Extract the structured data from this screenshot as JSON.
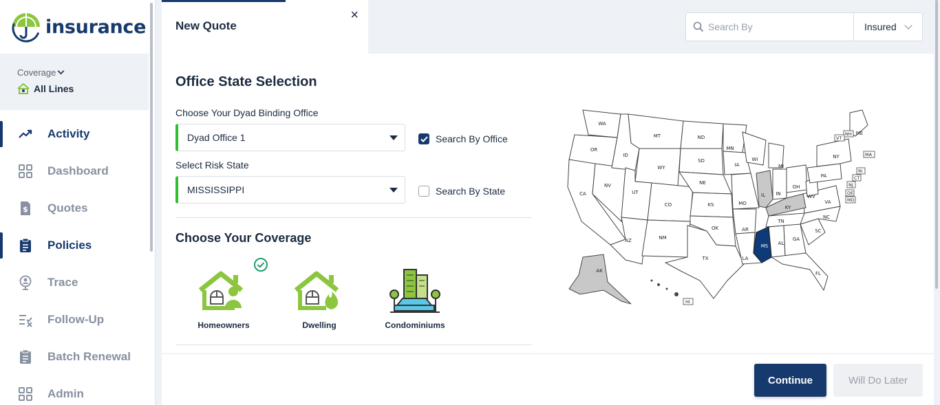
{
  "brand": {
    "name": "insurance",
    "collapse_icon": "chevron-left-icon"
  },
  "coverage": {
    "label": "Coverage",
    "value": "All Lines"
  },
  "nav": {
    "items": [
      {
        "label": "Activity",
        "icon": "trend-icon",
        "active": true
      },
      {
        "label": "Dashboard",
        "icon": "grid-icon",
        "active": false
      },
      {
        "label": "Quotes",
        "icon": "dollar-doc-icon",
        "active": false
      },
      {
        "label": "Policies",
        "icon": "clipboard-icon",
        "active": true
      },
      {
        "label": "Trace",
        "icon": "location-person-icon",
        "active": false
      },
      {
        "label": "Follow-Up",
        "icon": "list-check-icon",
        "active": false
      },
      {
        "label": "Batch Renewal",
        "icon": "clipboard-list-icon",
        "active": false
      },
      {
        "label": "Admin",
        "icon": "grid-icon",
        "active": false
      }
    ]
  },
  "tab": {
    "title": "New Quote",
    "close": "×"
  },
  "search": {
    "placeholder": "Search By",
    "type_value": "Insured"
  },
  "form": {
    "title": "Office State Selection",
    "office_label": "Choose Your Dyad Binding Office",
    "office_value": "Dyad Office 1",
    "search_by_office": {
      "label": "Search By Office",
      "checked": true
    },
    "state_label": "Select Risk State",
    "state_value": "MISSISSIPPI",
    "search_by_state": {
      "label": "Search By State",
      "checked": false
    }
  },
  "coverage_section": {
    "title": "Choose Your Coverage",
    "options": [
      {
        "name": "Homeowners",
        "selected": true
      },
      {
        "name": "Dwelling",
        "selected": false
      },
      {
        "name": "Condominiums",
        "selected": false
      }
    ]
  },
  "map": {
    "selected_state": "MS",
    "highlight_color": "#0d3b7a",
    "shaded_states": [
      "IL",
      "KY",
      "AK"
    ],
    "labels": [
      "WA",
      "OR",
      "CA",
      "NV",
      "ID",
      "MT",
      "WY",
      "UT",
      "AZ",
      "CO",
      "NM",
      "ND",
      "SD",
      "NE",
      "KS",
      "OK",
      "TX",
      "MN",
      "IA",
      "MO",
      "AR",
      "LA",
      "WI",
      "IL",
      "MI",
      "IN",
      "OH",
      "KY",
      "TN",
      "MS",
      "AL",
      "GA",
      "FL",
      "SC",
      "NC",
      "VA",
      "WV",
      "PA",
      "NY",
      "ME",
      "AK",
      "HI"
    ],
    "box_labels": [
      "NH",
      "VT",
      "MA",
      "RI",
      "CT",
      "NJ",
      "DE",
      "MD",
      "HI"
    ]
  },
  "actions": {
    "continue": "Continue",
    "later": "Will Do Later"
  }
}
